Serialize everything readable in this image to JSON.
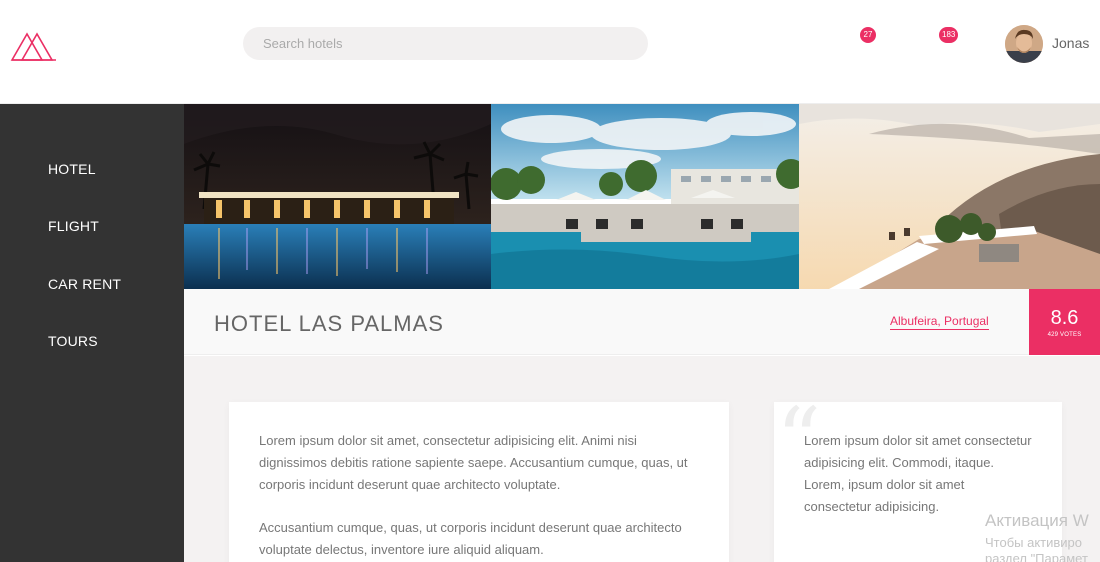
{
  "header": {
    "search_placeholder": "Search hotels",
    "notifications": [
      {
        "icon": "bookmark-icon",
        "count": "27"
      },
      {
        "icon": "chat-icon",
        "count": "183"
      }
    ],
    "user": {
      "name": "Jonas"
    }
  },
  "sidebar": {
    "items": [
      {
        "label": "HOTEL"
      },
      {
        "label": "FLIGHT"
      },
      {
        "label": "CAR RENT"
      },
      {
        "label": "TOURS"
      }
    ]
  },
  "gallery": {
    "photos": [
      "hotel-night-pool-photo",
      "hotel-day-pool-photo",
      "coastal-terrace-photo"
    ]
  },
  "overview": {
    "hotel_name": "HOTEL LAS PALMAS",
    "location": "Albufeira, Portugal",
    "rating_average": "8.6",
    "rating_count": "429 VOTES"
  },
  "description": {
    "paragraphs": [
      "Lorem ipsum dolor sit amet, consectetur adipisicing elit. Animi nisi dignissimos debitis ratione sapiente saepe. Accusantium cumque, quas, ut corporis incidunt deserunt quae architecto voluptate.",
      "Accusantium cumque, quas, ut corporis incidunt deserunt quae architecto voluptate delectus, inventore iure aliquid aliquam."
    ]
  },
  "review": {
    "text": "Lorem ipsum dolor sit amet consectetur adipisicing elit. Commodi, itaque. Lorem, ipsum dolor sit amet consectetur adipisicing."
  },
  "watermark": {
    "title": "Активация W",
    "line1": "Чтобы активиро",
    "line2": "раздел \"Парамет"
  },
  "colors": {
    "accent": "#eb2f64",
    "sidebar_bg": "#333333",
    "content_bg": "#f4f2f2"
  }
}
